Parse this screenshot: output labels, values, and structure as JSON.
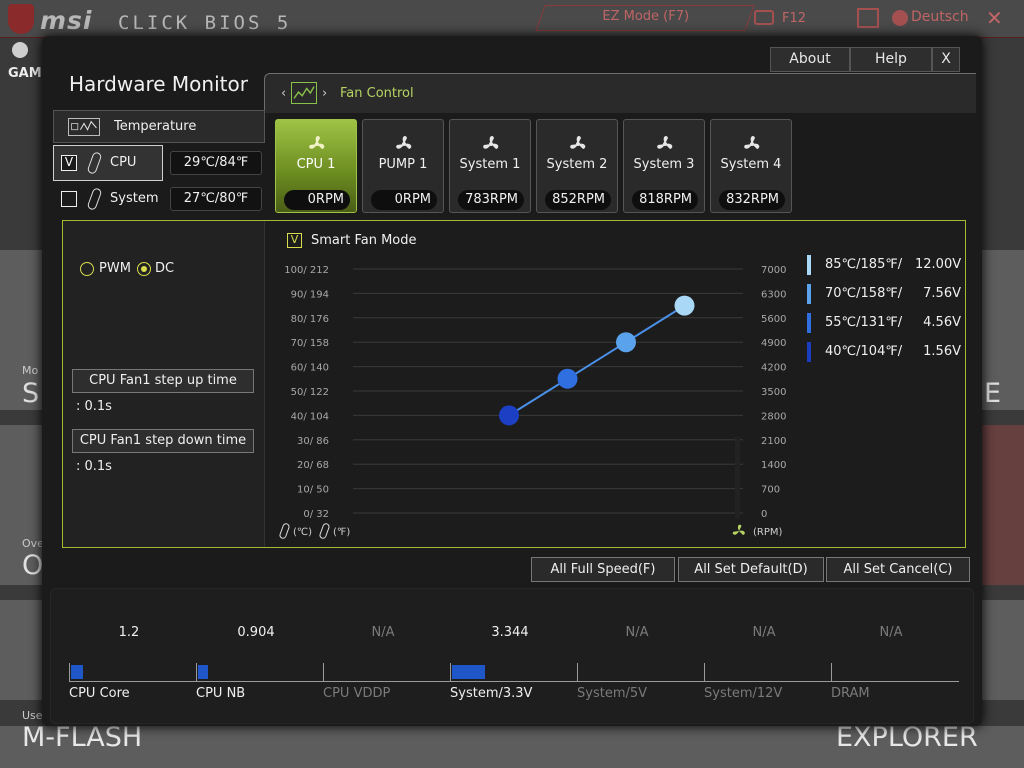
{
  "background": {
    "logo_text": "msi",
    "logo_sub": "CLICK BIOS 5",
    "ez_mode": "EZ Mode (F7)",
    "f12": "F12",
    "language": "Deutsch",
    "close": "✕",
    "game": "GAMI",
    "tiles": {
      "mo": "Mo",
      "s_big": "S",
      "ove": "Ove",
      "o_big": "O",
      "e_big": "E",
      "use": "Use",
      "mflash": "M-FLASH",
      "explorer": "EXPLORER"
    }
  },
  "window": {
    "title": "Hardware Monitor",
    "about": "About",
    "help": "Help",
    "close": "X"
  },
  "fan_control": {
    "title": "Fan Control",
    "arrow_left": "‹",
    "arrow_right": "›"
  },
  "temperature": {
    "title": "Temperature",
    "rows": [
      {
        "name": "CPU",
        "value": "29℃/84℉",
        "checked": true,
        "check_mark": "V"
      },
      {
        "name": "System",
        "value": "27℃/80℉",
        "checked": false,
        "check_mark": ""
      }
    ]
  },
  "fans": [
    {
      "name": "CPU 1",
      "rpm": "0RPM",
      "active": true
    },
    {
      "name": "PUMP 1",
      "rpm": "0RPM",
      "active": false
    },
    {
      "name": "System 1",
      "rpm": "783RPM",
      "active": false
    },
    {
      "name": "System 2",
      "rpm": "852RPM",
      "active": false
    },
    {
      "name": "System 3",
      "rpm": "818RPM",
      "active": false
    },
    {
      "name": "System 4",
      "rpm": "832RPM",
      "active": false
    }
  ],
  "mode": {
    "pwm": "PWM",
    "dc": "DC",
    "selected": "DC"
  },
  "step": {
    "up_label": "CPU Fan1 step up time",
    "up_value": ": 0.1s",
    "down_label": "CPU Fan1 step down time",
    "down_value": ": 0.1s"
  },
  "smart_fan": {
    "label": "Smart Fan Mode",
    "checked": true,
    "check_mark": "V"
  },
  "units": {
    "celsius": "(℃)",
    "fahrenheit": "(℉)",
    "rpm": "(RPM)"
  },
  "legend": [
    {
      "temp": "85℃/185℉/",
      "volt": "12.00V",
      "color": "#a9d8f7"
    },
    {
      "temp": "70℃/158℉/",
      "volt": "7.56V",
      "color": "#5aa3ec"
    },
    {
      "temp": "55℃/131℉/",
      "volt": "4.56V",
      "color": "#2f6fe0"
    },
    {
      "temp": "40℃/104℉/",
      "volt": "1.56V",
      "color": "#1a3ec0"
    }
  ],
  "chart_data": {
    "type": "line",
    "y_left_ticks": [
      "100/ 212",
      "90/ 194",
      "80/ 176",
      "70/ 158",
      "60/ 140",
      "50/ 122",
      "40/ 104",
      "30/  86",
      "20/  68",
      "10/  50",
      "0/  32"
    ],
    "y_right_ticks": [
      "7000",
      "6300",
      "5600",
      "4900",
      "4200",
      "3500",
      "2800",
      "2100",
      "1400",
      "700",
      "0"
    ],
    "ylim": [
      0,
      100
    ],
    "x": [
      40,
      55,
      70,
      85
    ],
    "series": [
      {
        "values": [
          40,
          55,
          70,
          85
        ]
      }
    ],
    "point_colors": [
      "#1c3fc4",
      "#2f6fe0",
      "#5aa3ec",
      "#a9d8f7"
    ],
    "rpm_indicator": 0
  },
  "bottom_buttons": {
    "full_speed": "All Full Speed(F)",
    "set_default": "All Set Default(D)",
    "set_cancel": "All Set Cancel(C)"
  },
  "voltages": [
    {
      "label": "CPU Core",
      "value": "1.2",
      "available": true,
      "level": 0.1
    },
    {
      "label": "CPU NB",
      "value": "0.904",
      "available": true,
      "level": 0.08
    },
    {
      "label": "CPU VDDP",
      "value": "N/A",
      "available": false,
      "level": 0
    },
    {
      "label": "System/3.3V",
      "value": "3.344",
      "available": true,
      "level": 0.27
    },
    {
      "label": "System/5V",
      "value": "N/A",
      "available": false,
      "level": 0
    },
    {
      "label": "System/12V",
      "value": "N/A",
      "available": false,
      "level": 0
    },
    {
      "label": "DRAM",
      "value": "N/A",
      "available": false,
      "level": 0
    }
  ]
}
